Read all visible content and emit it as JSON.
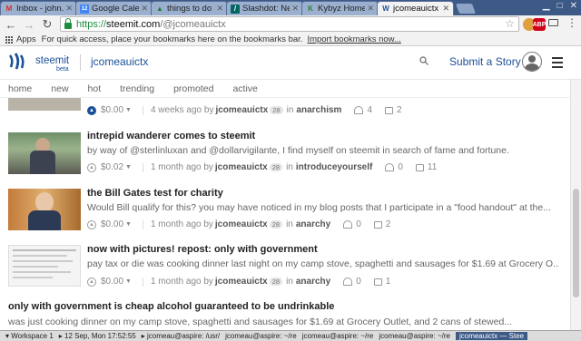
{
  "browser": {
    "tabs": [
      {
        "title": "Inbox - john.c",
        "icon": "gmail-icon",
        "icon_char": "M",
        "icon_color": "#d93025",
        "icon_bg": "#ffffff"
      },
      {
        "title": "Google Calen",
        "icon": "calendar-icon",
        "icon_char": "12",
        "icon_color": "#ffffff",
        "icon_bg": "#4285f4"
      },
      {
        "title": "things to do",
        "icon": "drive-icon",
        "icon_char": "▲",
        "icon_color": "#188038",
        "icon_bg": "transparent"
      },
      {
        "title": "Slashdot: New",
        "icon": "slashdot-icon",
        "icon_char": "/",
        "icon_color": "#ffffff",
        "icon_bg": "#026664"
      },
      {
        "title": "Kybyz Homep",
        "icon": "leaf-icon",
        "icon_char": "K",
        "icon_color": "#2e7d32",
        "icon_bg": "transparent"
      },
      {
        "title": "jcomeauictx",
        "icon": "steemit-icon",
        "icon_char": "W",
        "icon_color": "#1a5099",
        "icon_bg": "transparent",
        "active": true
      }
    ],
    "url": {
      "scheme": "https://",
      "host": "steemit.com",
      "path": "/@jcomeauictx"
    },
    "bookmarks": {
      "apps_label": "Apps",
      "hint": "For quick access, place your bookmarks here on the bookmarks bar.",
      "import_link": "Import bookmarks now..."
    },
    "extensions": [
      {
        "name": "cookie-icon",
        "char": "●",
        "color": "#e0a040"
      },
      {
        "name": "abp-icon",
        "char": "ABP",
        "color": "#d0021b"
      }
    ]
  },
  "header": {
    "brand": "steemit",
    "beta": "beta",
    "username": "jcomeauictx",
    "submit_label": "Submit a Story"
  },
  "subnav": [
    "home",
    "new",
    "hot",
    "trending",
    "promoted",
    "active"
  ],
  "posts": [
    {
      "title": "",
      "body": "",
      "payout": "$0.00",
      "upvoted": true,
      "time": "4 weeks ago by",
      "author": "jcomeauictx",
      "rep": "28",
      "in": "in",
      "category": "anarchism",
      "votes": "4",
      "comments": "2"
    },
    {
      "title": "intrepid wanderer comes to steemit",
      "body": "by way of @sterlinluxan and @dollarvigilante, I find myself on steemit in search of fame and fortune.",
      "payout": "$0.02",
      "upvoted": false,
      "time": "1 month ago by",
      "author": "jcomeauictx",
      "rep": "28",
      "in": "in",
      "category": "introduceyourself",
      "votes": "0",
      "comments": "11"
    },
    {
      "title": "the Bill Gates test for charity",
      "body": "Would Bill qualify for this? you may have noticed in my blog posts that I participate in a \"food handout\" at the...",
      "payout": "$0.00",
      "upvoted": false,
      "time": "1 month ago by",
      "author": "jcomeauictx",
      "rep": "28",
      "in": "in",
      "category": "anarchy",
      "votes": "0",
      "comments": "2"
    },
    {
      "title": "now with pictures! repost: only with government",
      "body": "pay tax or die was cooking dinner last night on my camp stove, spaghetti and sausages for $1.69 at Grocery O...",
      "payout": "$0.00",
      "upvoted": false,
      "time": "1 month ago by",
      "author": "jcomeauictx",
      "rep": "28",
      "in": "in",
      "category": "anarchy",
      "votes": "0",
      "comments": "1"
    },
    {
      "title": "only with government is cheap alcohol guaranteed to be undrinkable",
      "body": "was just cooking dinner on my camp stove, spaghetti and sausages for $1.69 at Grocery Outlet, and 2 cans of stewed..."
    }
  ],
  "taskbar": {
    "workspace": "▾ Workspace 1",
    "clock": "▸ 12 Sep, Mon 17:52:55",
    "items": [
      "▸ jcomeau@aspire: /usr/",
      "jcomeau@aspire: ~/re",
      "jcomeau@aspire: ~/re",
      "jcomeau@aspire: ~/re"
    ],
    "active_item": "jcomeauictx — Stee"
  }
}
